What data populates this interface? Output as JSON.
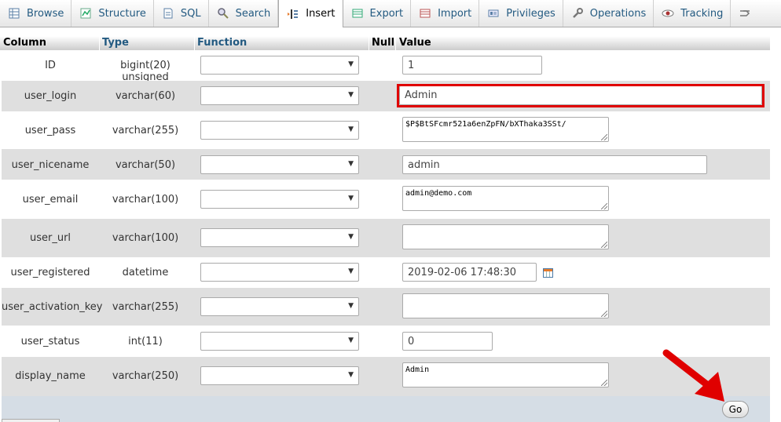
{
  "tabs": [
    {
      "label": "Browse",
      "icon": "browse-icon"
    },
    {
      "label": "Structure",
      "icon": "structure-icon"
    },
    {
      "label": "SQL",
      "icon": "sql-icon"
    },
    {
      "label": "Search",
      "icon": "search-icon"
    },
    {
      "label": "Insert",
      "icon": "insert-icon",
      "active": true
    },
    {
      "label": "Export",
      "icon": "export-icon"
    },
    {
      "label": "Import",
      "icon": "import-icon"
    },
    {
      "label": "Privileges",
      "icon": "privileges-icon"
    },
    {
      "label": "Operations",
      "icon": "operations-icon"
    },
    {
      "label": "Tracking",
      "icon": "tracking-icon"
    }
  ],
  "table": {
    "headers": {
      "column": "Column",
      "type": "Type",
      "function": "Function",
      "null": "Null",
      "value": "Value"
    },
    "rows": [
      {
        "column": "ID",
        "type": "bigint(20) unsigned",
        "value": "1"
      },
      {
        "column": "user_login",
        "type": "varchar(60)",
        "value": "Admin"
      },
      {
        "column": "user_pass",
        "type": "varchar(255)",
        "value": "$P$BtSFcmr521a6enZpFN/bXThaka3SSt/"
      },
      {
        "column": "user_nicename",
        "type": "varchar(50)",
        "value": "admin"
      },
      {
        "column": "user_email",
        "type": "varchar(100)",
        "value": "admin@demo.com"
      },
      {
        "column": "user_url",
        "type": "varchar(100)",
        "value": ""
      },
      {
        "column": "user_registered",
        "type": "datetime",
        "value": "2019-02-06 17:48:30"
      },
      {
        "column": "user_activation_key",
        "type": "varchar(255)",
        "value": ""
      },
      {
        "column": "user_status",
        "type": "int(11)",
        "value": "0"
      },
      {
        "column": "display_name",
        "type": "varchar(250)",
        "value": "Admin"
      }
    ]
  },
  "go_label": "Go",
  "colors": {
    "link": "#235a81",
    "highlight": "#e00000",
    "footer": "#d5dde5"
  }
}
